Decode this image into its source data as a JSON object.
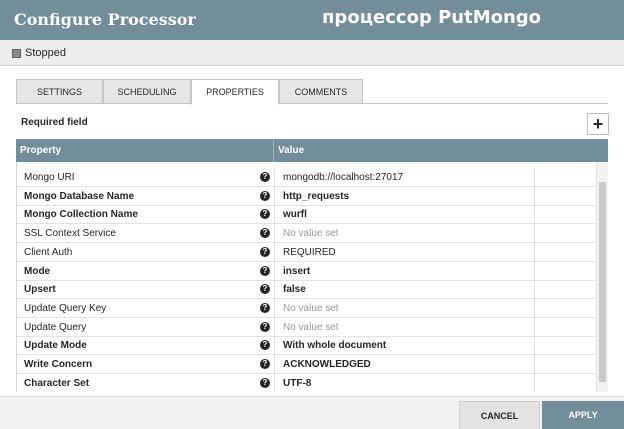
{
  "dialog": {
    "title": "Configure Processor",
    "overlay_caption": "процессор PutMongo"
  },
  "status": {
    "text": "Stopped"
  },
  "tabs": [
    {
      "label": "SETTINGS"
    },
    {
      "label": "SCHEDULING"
    },
    {
      "label": "PROPERTIES",
      "active": true
    },
    {
      "label": "COMMENTS"
    }
  ],
  "required_label": "Required field",
  "add_property_label": "+",
  "table": {
    "headers": {
      "property": "Property",
      "value": "Value"
    },
    "rows": [
      {
        "name": "Mongo URI",
        "value": "mongodb://localhost:27017",
        "required": false,
        "empty": false
      },
      {
        "name": "Mongo Database Name",
        "value": "http_requests",
        "required": true,
        "empty": false
      },
      {
        "name": "Mongo Collection Name",
        "value": "wurfl",
        "required": true,
        "empty": false
      },
      {
        "name": "SSL Context Service",
        "value": "No value set",
        "required": false,
        "empty": true
      },
      {
        "name": "Client Auth",
        "value": "REQUIRED",
        "required": false,
        "empty": false
      },
      {
        "name": "Mode",
        "value": "insert",
        "required": true,
        "empty": false
      },
      {
        "name": "Upsert",
        "value": "false",
        "required": true,
        "empty": false
      },
      {
        "name": "Update Query Key",
        "value": "No value set",
        "required": false,
        "empty": true
      },
      {
        "name": "Update Query",
        "value": "No value set",
        "required": false,
        "empty": true
      },
      {
        "name": "Update Mode",
        "value": "With whole document",
        "required": true,
        "empty": false
      },
      {
        "name": "Write Concern",
        "value": "ACKNOWLEDGED",
        "required": true,
        "empty": false
      },
      {
        "name": "Character Set",
        "value": "UTF-8",
        "required": true,
        "empty": false
      }
    ]
  },
  "buttons": {
    "cancel": "CANCEL",
    "apply": "APPLY"
  },
  "colors": {
    "header": "#728e9b",
    "apply": "#728e9b"
  }
}
